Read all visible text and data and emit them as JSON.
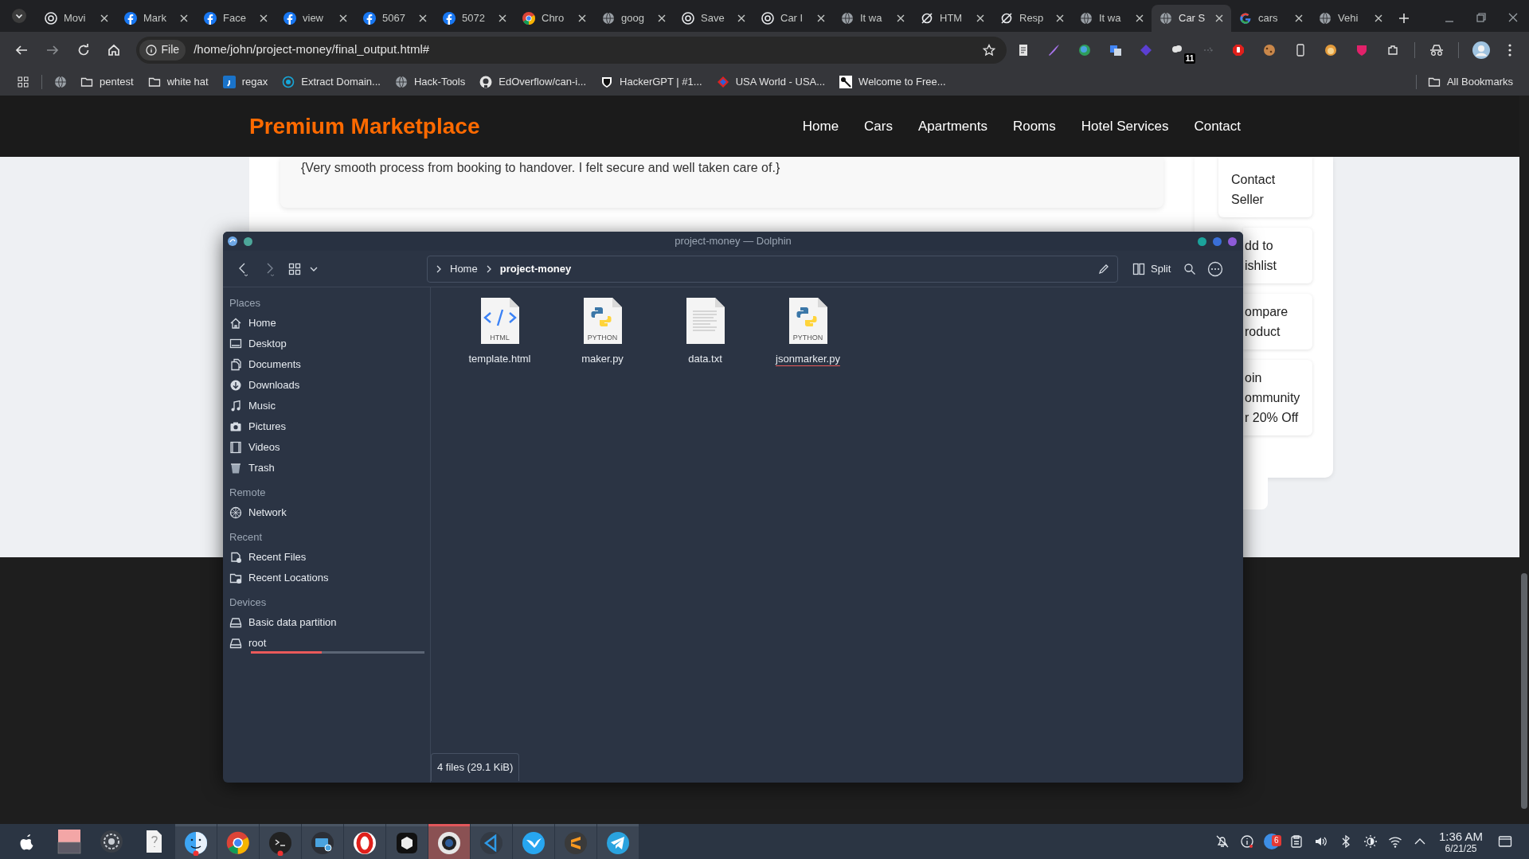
{
  "browser": {
    "tabs": [
      {
        "title": "Movi",
        "selected": false
      },
      {
        "title": "Mark",
        "selected": false
      },
      {
        "title": "Face",
        "selected": false
      },
      {
        "title": "view",
        "selected": false
      },
      {
        "title": "5067",
        "selected": false
      },
      {
        "title": "5072",
        "selected": false
      },
      {
        "title": "Chro",
        "selected": false
      },
      {
        "title": "goog",
        "selected": false
      },
      {
        "title": "Save",
        "selected": false
      },
      {
        "title": "Car I",
        "selected": false
      },
      {
        "title": "It wa",
        "selected": false
      },
      {
        "title": "HTM",
        "selected": false
      },
      {
        "title": "Resp",
        "selected": false
      },
      {
        "title": "It wa",
        "selected": false
      },
      {
        "title": "Car S",
        "selected": true
      },
      {
        "title": "cars",
        "selected": false
      },
      {
        "title": "Vehi",
        "selected": false
      }
    ],
    "address": {
      "chip": "File",
      "url": "/home/john/project-money/final_output.html#"
    },
    "extension_badge": "11",
    "bookmarks": [
      "pentest",
      "white hat",
      "regax",
      "Extract Domain...",
      "Hack-Tools",
      "EdOverflow/can-i...",
      "HackerGPT | #1...",
      "USA World - USA...",
      "Welcome to Free..."
    ],
    "all_bookmarks": "All Bookmarks"
  },
  "site": {
    "logo": "Premium Marketplace",
    "nav": [
      "Home",
      "Cars",
      "Apartments",
      "Rooms",
      "Hotel Services",
      "Contact"
    ],
    "review": "{Very smooth process from booking to handover. I felt secure and well taken care of.}",
    "side_actions": [
      {
        "lines": [
          "Contact",
          "Seller"
        ]
      },
      {
        "lines": [
          "dd to",
          "ishlist"
        ]
      },
      {
        "lines": [
          "ompare",
          "roduct"
        ]
      },
      {
        "lines": [
          "oin",
          "ommunity",
          "r 20% Off"
        ]
      }
    ]
  },
  "dolphin": {
    "title": "project-money — Dolphin",
    "breadcrumb": [
      "Home",
      "project-money"
    ],
    "split": "Split",
    "sidebar": [
      {
        "section": "Places",
        "items": [
          {
            "label": "Home"
          },
          {
            "label": "Desktop"
          },
          {
            "label": "Documents"
          },
          {
            "label": "Downloads"
          },
          {
            "label": "Music"
          },
          {
            "label": "Pictures"
          },
          {
            "label": "Videos"
          },
          {
            "label": "Trash"
          }
        ]
      },
      {
        "section": "Remote",
        "items": [
          {
            "label": "Network"
          }
        ]
      },
      {
        "section": "Recent",
        "items": [
          {
            "label": "Recent Files"
          },
          {
            "label": "Recent Locations"
          }
        ]
      },
      {
        "section": "Devices",
        "items": [
          {
            "label": "Basic data partition"
          },
          {
            "label": "root",
            "level": 0.41
          }
        ]
      }
    ],
    "files": [
      {
        "name": "template.html",
        "icon_label": "HTML",
        "underlined": false
      },
      {
        "name": "maker.py",
        "icon_label": "PYTHON",
        "underlined": false
      },
      {
        "name": "data.txt",
        "underlined": false
      },
      {
        "name": "jsonmarker.py",
        "icon_label": "PYTHON",
        "underlined": true
      }
    ],
    "status": "4 files (29.1 KiB)"
  },
  "taskbar": {
    "apps": [
      {
        "running": false,
        "active": false
      },
      {
        "running": false,
        "active": false
      },
      {
        "running": false,
        "active": false
      },
      {
        "running": false,
        "active": false
      },
      {
        "running": true,
        "active": false
      },
      {
        "running": true,
        "active": false
      },
      {
        "running": true,
        "active": false
      },
      {
        "running": true,
        "active": false
      },
      {
        "running": true,
        "active": false
      },
      {
        "running": true,
        "active": false
      },
      {
        "running": true,
        "active": true
      },
      {
        "running": true,
        "active": false
      },
      {
        "running": true,
        "active": false
      },
      {
        "running": true,
        "active": false
      },
      {
        "running": true,
        "active": false
      }
    ],
    "tray_badge": "6",
    "time": "1:36 AM",
    "date": "6/21/25"
  }
}
